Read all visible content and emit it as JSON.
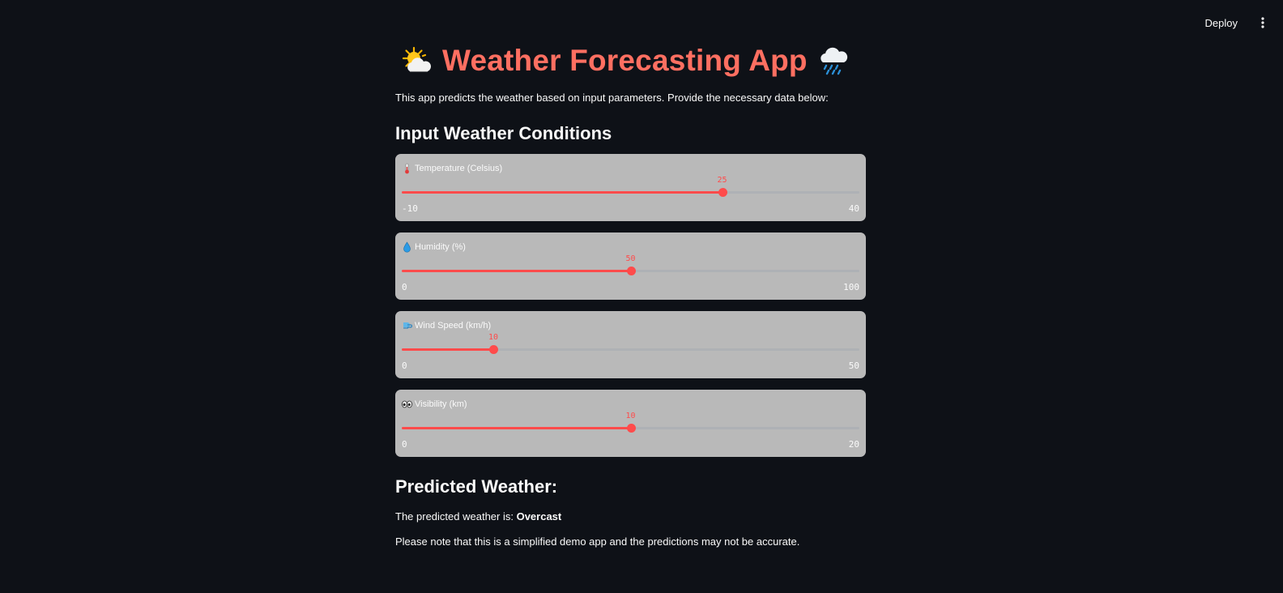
{
  "toolbar": {
    "deploy_label": "Deploy",
    "menu_icon": "vertical-ellipsis-icon"
  },
  "header": {
    "title": "Weather Forecasting App",
    "left_icon": "sun-behind-cloud-icon",
    "right_icon": "cloud-with-rain-icon",
    "title_color": "#ff6f61"
  },
  "intro": "This app predicts the weather based on input parameters. Provide the necessary data below:",
  "inputs": {
    "heading": "Input Weather Conditions",
    "sliders": [
      {
        "icon": "thermometer-icon",
        "label": "Temperature (Celsius)",
        "min": -10,
        "max": 40,
        "value": 25,
        "min_label": "-10",
        "max_label": "40"
      },
      {
        "icon": "droplet-icon",
        "label": "Humidity (%)",
        "min": 0,
        "max": 100,
        "value": 50,
        "min_label": "0",
        "max_label": "100"
      },
      {
        "icon": "wind-face-icon",
        "label": "Wind Speed (km/h)",
        "min": 0,
        "max": 50,
        "value": 10,
        "min_label": "0",
        "max_label": "50"
      },
      {
        "icon": "eyes-icon",
        "label": "Visibility (km)",
        "min": 0,
        "max": 20,
        "value": 10,
        "min_label": "0",
        "max_label": "20"
      }
    ]
  },
  "prediction": {
    "heading": "Predicted Weather:",
    "prefix": "The predicted weather is: ",
    "result": "Overcast",
    "note": "Please note that this is a simplified demo app and the predictions may not be accurate."
  },
  "colors": {
    "background": "#0e1117",
    "card": "#b9b9b9",
    "accent": "#ff4b4b"
  }
}
